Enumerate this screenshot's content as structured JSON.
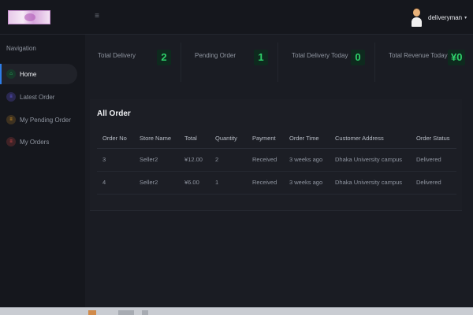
{
  "topbar": {
    "menu_icon": "hamburger-icon",
    "user": {
      "name": "deliveryman",
      "caret": "▾"
    }
  },
  "sidebar": {
    "heading": "Navigation",
    "items": [
      {
        "label": "Home",
        "icon": "home-icon",
        "color": "#2fd36b",
        "active": true
      },
      {
        "label": "Latest Order",
        "icon": "list-icon",
        "color": "#6e63ff",
        "active": false
      },
      {
        "label": "My Pending Order",
        "icon": "list-icon",
        "color": "#f5a623",
        "active": false
      },
      {
        "label": "My Orders",
        "icon": "list-icon",
        "color": "#ef4f4f",
        "active": false
      }
    ]
  },
  "stats": [
    {
      "label": "Total Delivery",
      "value": "2"
    },
    {
      "label": "Pending Order",
      "value": "1"
    },
    {
      "label": "Total Delivery Today",
      "value": "0"
    },
    {
      "label": "Total Revenue Today",
      "value": "¥0"
    }
  ],
  "orders": {
    "title": "All Order",
    "columns": [
      "Order No",
      "Store Name",
      "Total",
      "Quantity",
      "Payment",
      "Order Time",
      "Customer Address",
      "Order Status"
    ],
    "rows": [
      [
        "3",
        "Seller2",
        "¥12.00",
        "2",
        "Received",
        "3 weeks ago",
        "Dhaka University campus",
        "Delivered"
      ],
      [
        "4",
        "Seller2",
        "¥6.00",
        "1",
        "Received",
        "3 weeks ago",
        "Dhaka University campus",
        "Delivered"
      ]
    ]
  },
  "colors": {
    "accent": "#2d7de8",
    "stat_value": "#2fd36b",
    "background": "#1a1c23"
  }
}
